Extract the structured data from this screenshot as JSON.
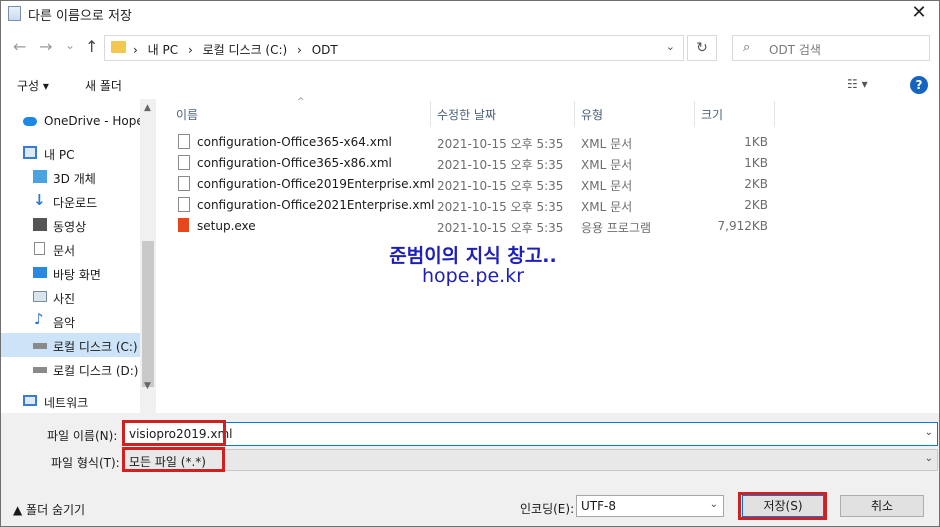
{
  "window": {
    "title": "다른 이름으로 저장",
    "close": "✕"
  },
  "nav": {
    "back": "←",
    "forward": "→",
    "recent": "⌄",
    "up": "↑",
    "breadcrumb": [
      "›",
      "내 PC",
      "›",
      "로컬 디스크 (C:)",
      "›",
      "ODT"
    ],
    "dropdown": "⌄",
    "refresh": "↻",
    "search_placeholder": "ODT 검색",
    "search_icon": "⌕"
  },
  "toolbar": {
    "organize": "구성 ▾",
    "new_folder": "새 폴더",
    "view": "☷ ▾",
    "help": "?"
  },
  "sidebar": {
    "items": [
      {
        "label": "OneDrive - Hope",
        "icon": "cloud-icon",
        "color": "#1e88e5"
      },
      {
        "label": "내 PC",
        "icon": "computer-icon",
        "color": "#3a7bd5"
      },
      {
        "label": "3D 개체",
        "icon": "cube-icon",
        "color": "#4aa3df"
      },
      {
        "label": "다운로드",
        "icon": "download-icon",
        "color": "#2a7ad5"
      },
      {
        "label": "동영상",
        "icon": "video-icon",
        "color": "#555555"
      },
      {
        "label": "문서",
        "icon": "document-icon",
        "color": "#8a8a8a"
      },
      {
        "label": "바탕 화면",
        "icon": "desktop-icon",
        "color": "#2a88e0"
      },
      {
        "label": "사진",
        "icon": "picture-icon",
        "color": "#7a8a9a"
      },
      {
        "label": "음악",
        "icon": "music-icon",
        "color": "#2a6fd5"
      },
      {
        "label": "로컬 디스크 (C:)",
        "icon": "drive-icon",
        "color": "#6a6a6a"
      },
      {
        "label": "로컬 디스크 (D:)",
        "icon": "drive-icon",
        "color": "#6a6a6a"
      },
      {
        "label": "네트워크",
        "icon": "network-icon",
        "color": "#3a7bd5"
      }
    ]
  },
  "columns": {
    "name": "이름",
    "date": "수정한 날짜",
    "type": "유형",
    "size": "크기"
  },
  "files": [
    {
      "name": "configuration-Office365-x64.xml",
      "date": "2021-10-15 오후 5:35",
      "type": "XML 문서",
      "size": "1KB",
      "icon": "xml-file-icon"
    },
    {
      "name": "configuration-Office365-x86.xml",
      "date": "2021-10-15 오후 5:35",
      "type": "XML 문서",
      "size": "1KB",
      "icon": "xml-file-icon"
    },
    {
      "name": "configuration-Office2019Enterprise.xml",
      "date": "2021-10-15 오후 5:35",
      "type": "XML 문서",
      "size": "2KB",
      "icon": "xml-file-icon"
    },
    {
      "name": "configuration-Office2021Enterprise.xml",
      "date": "2021-10-15 오후 5:35",
      "type": "XML 문서",
      "size": "2KB",
      "icon": "xml-file-icon"
    },
    {
      "name": "setup.exe",
      "date": "2021-10-15 오후 5:35",
      "type": "응용 프로그램",
      "size": "7,912KB",
      "icon": "office-exe-icon"
    }
  ],
  "watermark": {
    "line1": "준범이의 지식 창고..",
    "line2": "hope.pe.kr"
  },
  "form": {
    "filename_label": "파일 이름(N):",
    "filename_value": "visiopro2019.xml",
    "filetype_label": "파일 형식(T):",
    "filetype_value": "모든 파일 (*.*)",
    "hide_folders": "▲ 폴더 숨기기",
    "encoding_label": "인코딩(E):",
    "encoding_value": "UTF-8",
    "save": "저장(S)",
    "cancel": "취소"
  },
  "colors": {
    "highlight": "#d02020",
    "accent": "#0078d7",
    "watermark": "#1d1fb8"
  }
}
